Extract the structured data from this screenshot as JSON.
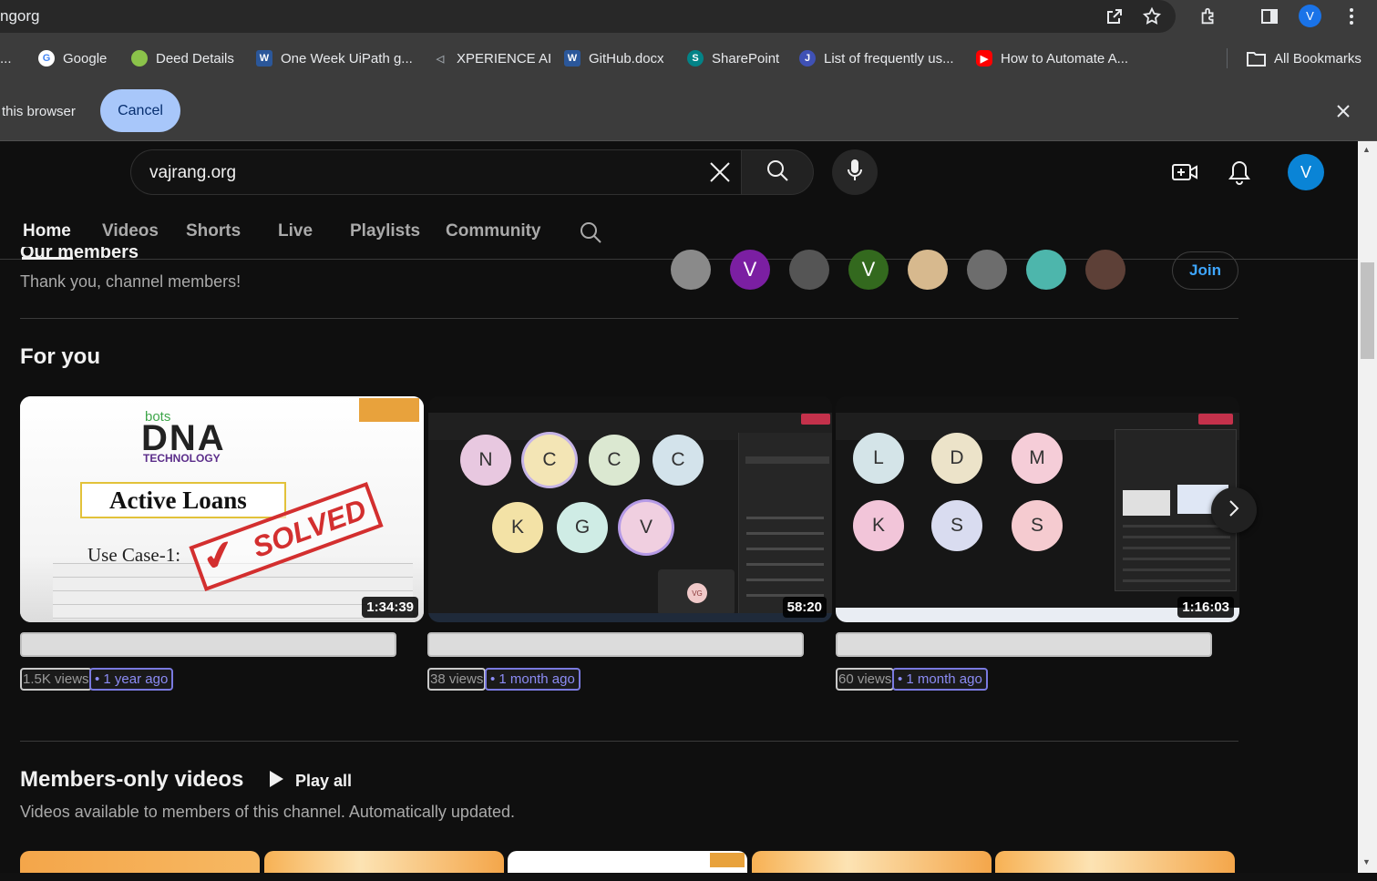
{
  "browser": {
    "url_fragment": "ngorg",
    "profile_initial": "V",
    "bookmarks": [
      {
        "label": "...",
        "color": "#9aa0a6"
      },
      {
        "label": "Google",
        "color": "#ffffff"
      },
      {
        "label": "Deed Details",
        "color": "#8bc34a"
      },
      {
        "label": "One Week UiPath g...",
        "color": "#2b579a"
      },
      {
        "label": "XPERIENCE AI",
        "color": "#5f6368"
      },
      {
        "label": "GitHub.docx",
        "color": "#2b579a"
      },
      {
        "label": "SharePoint",
        "color": "#038387"
      },
      {
        "label": "List of frequently us...",
        "color": "#3f51b5"
      },
      {
        "label": "How to Automate A...",
        "color": "#ff0000"
      }
    ],
    "all_bookmarks": "All Bookmarks",
    "infobar_text": "this browser",
    "cancel_label": "Cancel"
  },
  "header": {
    "search_value": "vajrang.org",
    "avatar_initial": "V"
  },
  "tabs": [
    "Home",
    "Videos",
    "Shorts",
    "Live",
    "Playlists",
    "Community"
  ],
  "members": {
    "title": "Our members",
    "subtitle": "Thank you, channel members!",
    "join_label": "Join",
    "avatars": [
      {
        "initial": "",
        "color": "#8a8a8a"
      },
      {
        "initial": "V",
        "color": "#7b1fa2"
      },
      {
        "initial": "",
        "color": "#555555"
      },
      {
        "initial": "V",
        "color": "#33691e"
      },
      {
        "initial": "",
        "color": "#d7b98e"
      },
      {
        "initial": "",
        "color": "#6d6d6d"
      },
      {
        "initial": "",
        "color": "#4db6ac"
      },
      {
        "initial": "",
        "color": "#5d4037"
      }
    ]
  },
  "for_you": {
    "title": "For you",
    "videos": [
      {
        "duration": "1:34:39",
        "views": "1.5K views",
        "date": "• 1 year ago",
        "brand_small": "bots",
        "brand_big": "DNA",
        "brand_sub": "TECHNOLOGY",
        "heading": "Active Loans",
        "usecase": "Use Case-1:",
        "stamp": "SOLVED"
      },
      {
        "duration": "58:20",
        "views": "38 views",
        "date": "• 1 month ago",
        "participants": [
          "N",
          "C",
          "C",
          "C",
          "K",
          "G",
          "V"
        ],
        "badge": "VG"
      },
      {
        "duration": "1:16:03",
        "views": "60 views",
        "date": "• 1 month ago",
        "participants": [
          "L",
          "D",
          "M",
          "K",
          "S",
          "S"
        ]
      }
    ]
  },
  "members_only": {
    "title": "Members-only videos",
    "play_all": "Play all",
    "subtitle": "Videos available to members of this channel. Automatically updated."
  }
}
